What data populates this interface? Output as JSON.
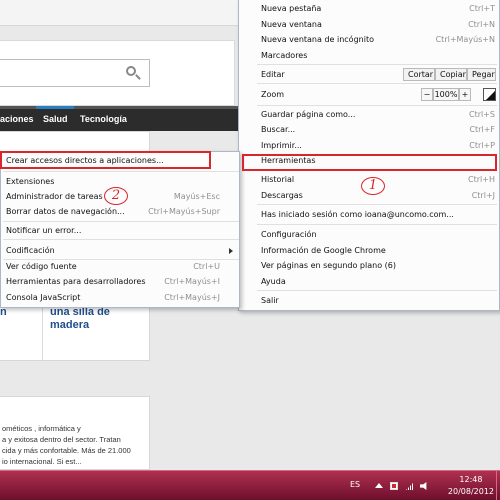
{
  "page": {
    "nav": [
      "aciones",
      "Salud",
      "Tecnología"
    ],
    "headlines": {
      "left": "n",
      "right": [
        "una silla de",
        "madera"
      ]
    },
    "body_text": [
      "ométicos , informática y",
      "a y exitosa dentro del sector. Tratan",
      "cida y más confortable. Más de 21.000",
      "io internacional. Si est..."
    ]
  },
  "chrome_menu": {
    "items": {
      "new_tab": {
        "label": "Nueva pestaña",
        "shortcut": "Ctrl+T"
      },
      "new_window": {
        "label": "Nueva ventana",
        "shortcut": "Ctrl+N"
      },
      "incognito": {
        "label": "Nueva ventana de incógnito",
        "shortcut": "Ctrl+Mayús+N"
      },
      "bookmarks": {
        "label": "Marcadores"
      },
      "edit": {
        "label": "Editar",
        "cut": "Cortar",
        "copy": "Copiar",
        "paste": "Pegar"
      },
      "zoom": {
        "label": "Zoom",
        "minus": "−",
        "value": "100%",
        "plus": "+"
      },
      "save_page": {
        "label": "Guardar página como...",
        "shortcut": "Ctrl+S"
      },
      "find": {
        "label": "Buscar...",
        "shortcut": "Ctrl+F"
      },
      "print": {
        "label": "Imprimir...",
        "shortcut": "Ctrl+P"
      },
      "tools": {
        "label": "Herramientas"
      },
      "history": {
        "label": "Historial",
        "shortcut": "Ctrl+H"
      },
      "downloads": {
        "label": "Descargas",
        "shortcut": "Ctrl+J"
      },
      "signed_in": {
        "label": "Has iniciado sesión como ioana@uncomo.com..."
      },
      "settings": {
        "label": "Configuración"
      },
      "about": {
        "label": "Información de Google Chrome"
      },
      "background_pages": {
        "label": "Ver páginas en segundo plano (6)"
      },
      "help": {
        "label": "Ayuda"
      },
      "exit": {
        "label": "Salir"
      }
    }
  },
  "tools_menu": {
    "items": {
      "create_shortcuts": {
        "label": "Crear accesos directos a aplicaciones..."
      },
      "extensions": {
        "label": "Extensiones"
      },
      "task_manager": {
        "label": "Administrador de tareas",
        "shortcut": "Mayús+Esc"
      },
      "clear_data": {
        "label": "Borrar datos de navegación...",
        "shortcut": "Ctrl+Mayús+Supr"
      },
      "report_error": {
        "label": "Notificar un error..."
      },
      "encoding": {
        "label": "Codificación"
      },
      "view_source": {
        "label": "Ver código fuente",
        "shortcut": "Ctrl+U"
      },
      "dev_tools": {
        "label": "Herramientas para desarrolladores",
        "shortcut": "Ctrl+Mayús+I"
      },
      "js_console": {
        "label": "Consola JavaScript",
        "shortcut": "Ctrl+Mayús+J"
      }
    }
  },
  "annotations": {
    "step1": "1",
    "step2": "2",
    "color": "#d9262c"
  },
  "taskbar": {
    "language": "ES",
    "time": "12:48",
    "date": "20/08/2012",
    "tray_icons": [
      "show-hidden-icon",
      "flag-icon",
      "network-icon",
      "volume-icon"
    ]
  }
}
